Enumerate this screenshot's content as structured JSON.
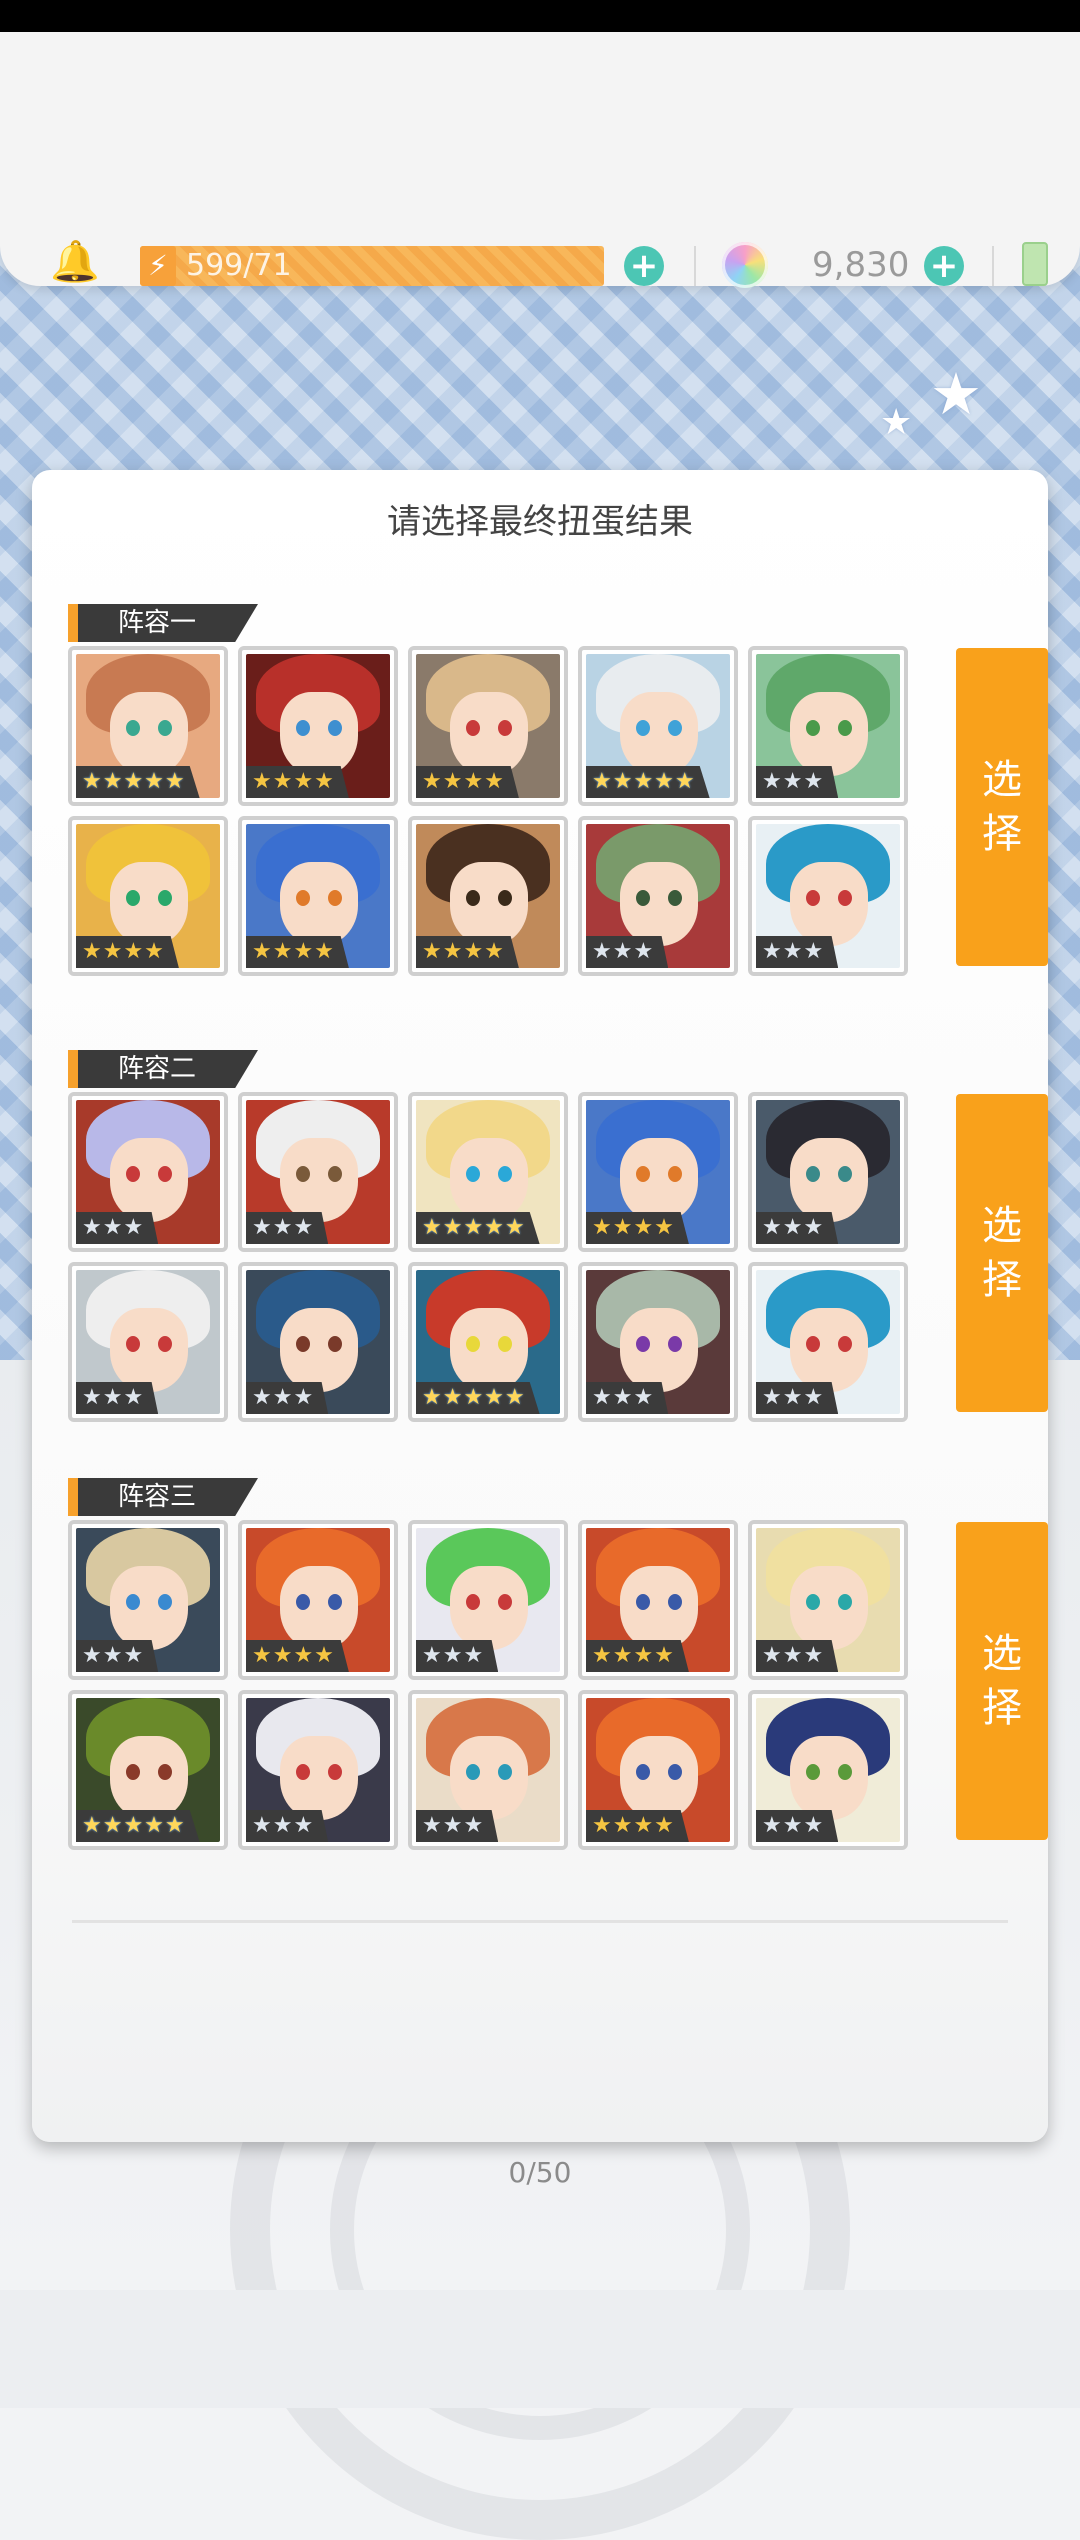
{
  "topbar": {
    "energy": "599/71",
    "gems": "9,830"
  },
  "dialog": {
    "title": "请选择最终扭蛋结果",
    "select_label": [
      "选",
      "择"
    ],
    "teams": [
      {
        "label": "阵容一",
        "heroes": [
          {
            "stars": 5,
            "hair": "#c87a52",
            "eye": "#3aa890",
            "bg": "#e7a980"
          },
          {
            "stars": 4,
            "hair": "#b8302a",
            "eye": "#3e8fd0",
            "bg": "#6a1e1a"
          },
          {
            "stars": 4,
            "hair": "#d9b88a",
            "eye": "#c83a3a",
            "bg": "#8a7a6a"
          },
          {
            "stars": 5,
            "hair": "#e8ecef",
            "eye": "#3fa2d8",
            "bg": "#b9d3e4"
          },
          {
            "stars": 3,
            "hair": "#5fa86a",
            "eye": "#4a9a4a",
            "bg": "#8ac49a"
          },
          {
            "stars": 4,
            "hair": "#f0c23a",
            "eye": "#2aa86a",
            "bg": "#e8b24a"
          },
          {
            "stars": 4,
            "hair": "#3a6fd0",
            "eye": "#e07a2a",
            "bg": "#4a78c8"
          },
          {
            "stars": 4,
            "hair": "#4a3020",
            "eye": "#3a2a1a",
            "bg": "#c08a5a"
          },
          {
            "stars": 3,
            "hair": "#7a9a6a",
            "eye": "#3a5a3a",
            "bg": "#a83a3a"
          },
          {
            "stars": 3,
            "hair": "#2a9ac8",
            "eye": "#c83a3a",
            "bg": "#e8f0f4"
          }
        ]
      },
      {
        "label": "阵容二",
        "heroes": [
          {
            "stars": 3,
            "hair": "#b8b8e8",
            "eye": "#c83a3a",
            "bg": "#a83a2a"
          },
          {
            "stars": 3,
            "hair": "#eeeeee",
            "eye": "#7a5a3a",
            "bg": "#b83a2a"
          },
          {
            "stars": 5,
            "hair": "#f2d88a",
            "eye": "#2aa8d8",
            "bg": "#f0e4c0"
          },
          {
            "stars": 4,
            "hair": "#3a6fd0",
            "eye": "#e07a2a",
            "bg": "#4a78c8"
          },
          {
            "stars": 3,
            "hair": "#2a2a32",
            "eye": "#3a8a8a",
            "bg": "#4a5a6a"
          },
          {
            "stars": 3,
            "hair": "#eeeeee",
            "eye": "#c83a3a",
            "bg": "#c0c8cc"
          },
          {
            "stars": 3,
            "hair": "#2a5a8a",
            "eye": "#7a3a2a",
            "bg": "#3a4a5a"
          },
          {
            "stars": 5,
            "hair": "#c83a2a",
            "eye": "#e8d83a",
            "bg": "#2a6a8a"
          },
          {
            "stars": 3,
            "hair": "#a8b8a8",
            "eye": "#7a3aa8",
            "bg": "#5a3a3a"
          },
          {
            "stars": 3,
            "hair": "#2a9ac8",
            "eye": "#c83a3a",
            "bg": "#e8f0f4"
          }
        ]
      },
      {
        "label": "阵容三",
        "heroes": [
          {
            "stars": 3,
            "hair": "#d8c8a0",
            "eye": "#3a8ad0",
            "bg": "#3a4a5a"
          },
          {
            "stars": 4,
            "hair": "#e86a2a",
            "eye": "#3a5aa8",
            "bg": "#c84a2a"
          },
          {
            "stars": 3,
            "hair": "#5ac85a",
            "eye": "#c83a3a",
            "bg": "#e8e8f0"
          },
          {
            "stars": 4,
            "hair": "#e86a2a",
            "eye": "#3a5aa8",
            "bg": "#c84a2a"
          },
          {
            "stars": 3,
            "hair": "#f0e0a0",
            "eye": "#2aa8a8",
            "bg": "#e8dcb0"
          },
          {
            "stars": 5,
            "hair": "#6a8a2a",
            "eye": "#8a3a2a",
            "bg": "#3a4a2a"
          },
          {
            "stars": 3,
            "hair": "#e8e8ee",
            "eye": "#c83a3a",
            "bg": "#3a3a4a"
          },
          {
            "stars": 3,
            "hair": "#d8784a",
            "eye": "#2a9ab8",
            "bg": "#eadcc8"
          },
          {
            "stars": 4,
            "hair": "#e86a2a",
            "eye": "#3a5aa8",
            "bg": "#c84a2a"
          },
          {
            "stars": 3,
            "hair": "#2a3a7a",
            "eye": "#5a9a3a",
            "bg": "#f0ecd8"
          }
        ]
      }
    ]
  },
  "footer": {
    "counter": "0/50"
  }
}
